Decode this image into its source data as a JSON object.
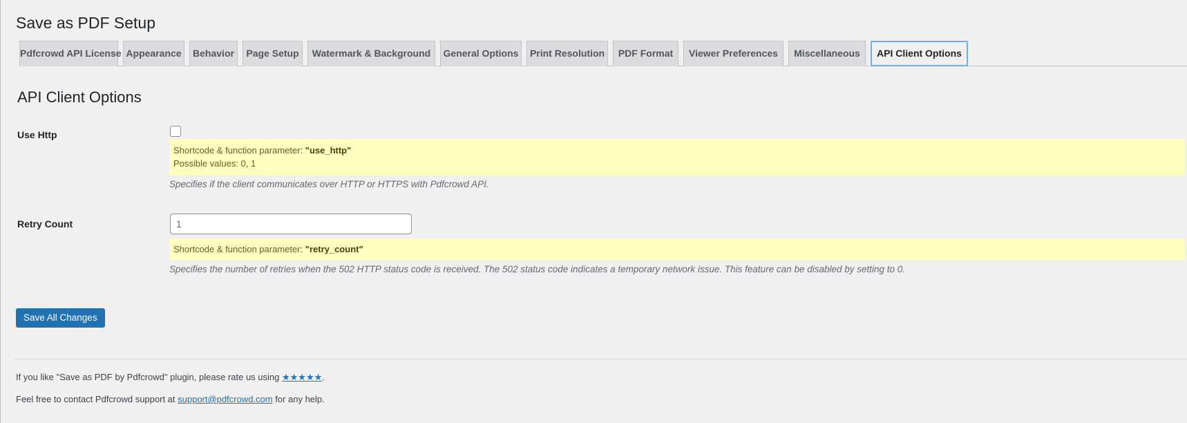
{
  "page": {
    "title": "Save as PDF Setup"
  },
  "tabs": [
    {
      "label": "Pdfcrowd API License"
    },
    {
      "label": "Appearance"
    },
    {
      "label": "Behavior"
    },
    {
      "label": "Page Setup"
    },
    {
      "label": "Watermark & Background"
    },
    {
      "label": "General Options"
    },
    {
      "label": "Print Resolution"
    },
    {
      "label": "PDF Format"
    },
    {
      "label": "Viewer Preferences"
    },
    {
      "label": "Miscellaneous"
    },
    {
      "label": "API Client Options",
      "active": true
    }
  ],
  "section": {
    "title": "API Client Options"
  },
  "fields": {
    "use_http": {
      "label": "Use Http",
      "checked": false,
      "note_prefix": "Shortcode & function parameter: ",
      "note_param": "\"use_http\"",
      "note_values": "Possible values: 0, 1",
      "description": "Specifies if the client communicates over HTTP or HTTPS with Pdfcrowd API."
    },
    "retry_count": {
      "label": "Retry Count",
      "value": "1",
      "note_prefix": "Shortcode & function parameter: ",
      "note_param": "\"retry_count\"",
      "description": "Specifies the number of retries when the 502 HTTP status code is received. The 502 status code indicates a temporary network issue. This feature can be disabled by setting to 0."
    }
  },
  "buttons": {
    "save": "Save All Changes"
  },
  "footer": {
    "rate_prefix": "If you like \"Save as PDF by Pdfcrowd\" plugin, please rate us using ",
    "rate_stars": "★★★★★",
    "rate_suffix": ".",
    "support_prefix": "Feel free to contact Pdfcrowd support at ",
    "support_email": "support@pdfcrowd.com",
    "support_suffix": " for any help."
  },
  "colors": {
    "accent": "#2271b1",
    "note_bg": "#ffffc0",
    "active_tab_border": "#72aee6"
  }
}
